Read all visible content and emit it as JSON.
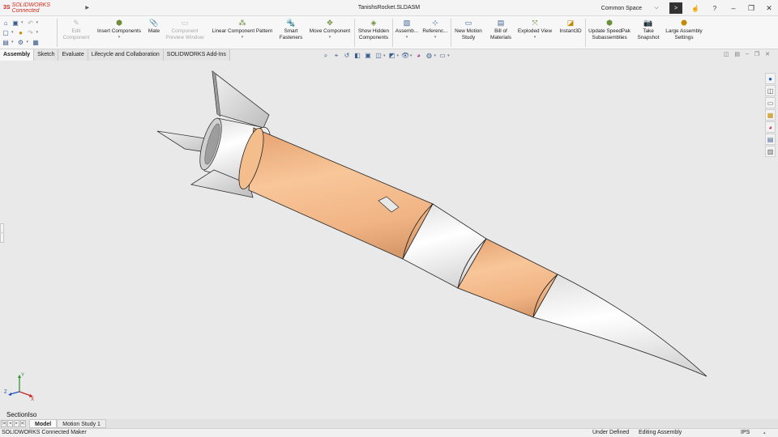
{
  "titlebar": {
    "brand_mark": "3S",
    "brand_name": "SOLIDWORKS Connected",
    "document_title": "TanishsRocket.SLDASM",
    "workspace": "Common Space"
  },
  "ribbon": {
    "buttons": [
      {
        "label1": "Edit",
        "label2": "Component",
        "icon": "edit-component-icon",
        "enabled": false
      },
      {
        "label1": "Insert Components",
        "label2": "",
        "icon": "insert-components-icon",
        "enabled": true
      },
      {
        "label1": "Mate",
        "label2": "",
        "icon": "mate-icon",
        "enabled": true
      },
      {
        "label1": "Component",
        "label2": "Preview Window",
        "icon": "component-preview-icon",
        "enabled": false
      },
      {
        "label1": "Linear Component Pattern",
        "label2": "",
        "icon": "linear-pattern-icon",
        "enabled": true
      },
      {
        "label1": "Smart",
        "label2": "Fasteners",
        "icon": "smart-fasteners-icon",
        "enabled": true
      },
      {
        "label1": "Move Component",
        "label2": "",
        "icon": "move-component-icon",
        "enabled": true
      },
      {
        "label1": "Show Hidden",
        "label2": "Components",
        "icon": "show-hidden-icon",
        "enabled": true
      },
      {
        "label1": "Assemb...",
        "label2": "",
        "icon": "assembly-features-icon",
        "enabled": true
      },
      {
        "label1": "Referenc...",
        "label2": "",
        "icon": "reference-geometry-icon",
        "enabled": true
      },
      {
        "label1": "New Motion",
        "label2": "Study",
        "icon": "motion-study-icon",
        "enabled": true
      },
      {
        "label1": "Bill of",
        "label2": "Materials",
        "icon": "bom-icon",
        "enabled": true
      },
      {
        "label1": "Exploded View",
        "label2": "",
        "icon": "exploded-view-icon",
        "enabled": true
      },
      {
        "label1": "Instant3D",
        "label2": "",
        "icon": "instant3d-icon",
        "enabled": true
      },
      {
        "label1": "Update SpeedPak",
        "label2": "Subassemblies",
        "icon": "speedpak-icon",
        "enabled": true
      },
      {
        "label1": "Take",
        "label2": "Snapshot",
        "icon": "snapshot-icon",
        "enabled": true
      },
      {
        "label1": "Large Assembly",
        "label2": "Settings",
        "icon": "large-assembly-icon",
        "enabled": true
      }
    ]
  },
  "tabs": [
    "Assembly",
    "Sketch",
    "Evaluate",
    "Lifecycle and Collaboration",
    "SOLIDWORKS Add-Ins"
  ],
  "viewport": {
    "view_name": "SectionIso",
    "triad_labels": {
      "x": "X",
      "y": "Y",
      "z": "Z"
    },
    "colors": {
      "background": "#e9e9e9",
      "body_orange": "#f2ba8a",
      "nose_white": "#ffffff",
      "fin_gray": "#d9d9d9",
      "edge": "#1a1a1a"
    }
  },
  "bottom_tabs": [
    "Model",
    "Motion Study 1"
  ],
  "statusbar": {
    "left": "SOLIDWORKS Connected Maker",
    "definition": "Under Defined",
    "mode": "Editing Assembly",
    "units": "IPS"
  }
}
